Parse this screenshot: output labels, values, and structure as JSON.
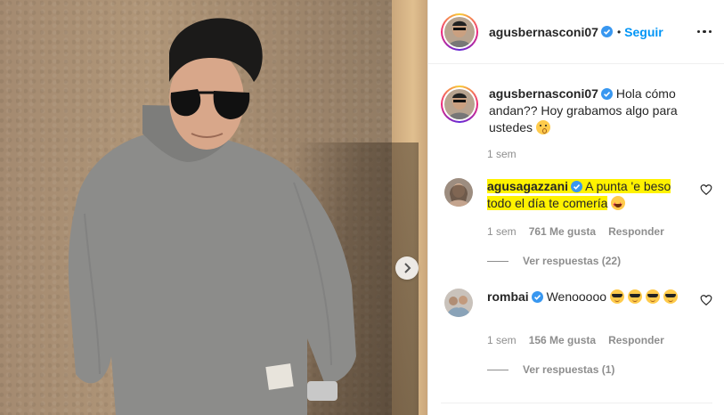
{
  "post": {
    "author": "agusbernasconi07",
    "follow_label": "Seguir",
    "separator": "•",
    "caption": "Hola cómo andan?? Hoy grabamos algo para ustedes",
    "caption_time": "1 sem"
  },
  "comments": [
    {
      "user": "agusagazzani",
      "text": "A punta 'e beso todo el día te comería",
      "time": "1 sem",
      "likes": "761 Me gusta",
      "reply_label": "Responder",
      "view_replies": "Ver respuestas (22)"
    },
    {
      "user": "rombai",
      "text": "Wenooooo",
      "time": "1 sem",
      "likes": "156 Me gusta",
      "reply_label": "Responder",
      "view_replies": "Ver respuestas (1)"
    }
  ],
  "icons": {
    "verified": "verified-badge-icon",
    "more": "more-options-icon",
    "heart": "heart-icon",
    "next": "chevron-right-icon"
  },
  "colors": {
    "accent": "#0095f6",
    "highlight": "#fff200",
    "muted": "#8e8e8e",
    "verified": "#3897f0"
  }
}
